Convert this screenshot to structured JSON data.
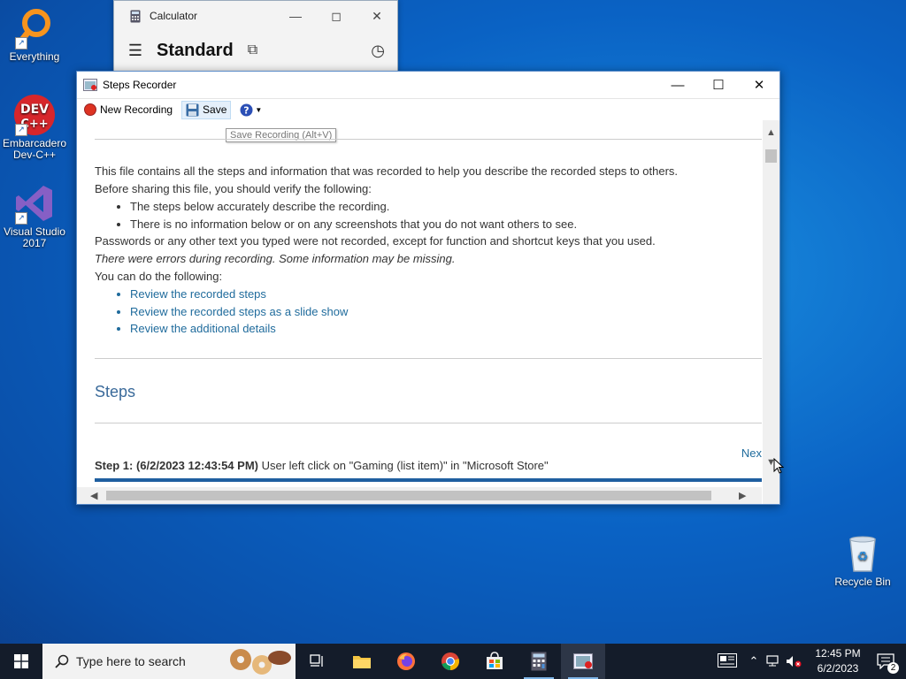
{
  "desktop": {
    "icons": [
      {
        "label": "Everything"
      },
      {
        "label": "Embarcadero Dev-C++"
      },
      {
        "label": "Visual Studio 2017"
      },
      {
        "label": "Recycle Bin"
      }
    ]
  },
  "calculator": {
    "title": "Calculator",
    "mode": "Standard"
  },
  "steps_recorder": {
    "title": "Steps Recorder",
    "toolbar": {
      "new_recording": "New Recording",
      "save": "Save",
      "save_tooltip": "Save Recording (Alt+V)"
    },
    "intro": "This file contains all the steps and information that was recorded to help you describe the recorded steps to others.",
    "verify_heading": "Before sharing this file, you should verify the following:",
    "verify_items": [
      "The steps below accurately describe the recording.",
      "There is no information below or on any screenshots that you do not want others to see."
    ],
    "passwords_note": "Passwords or any other text you typed were not recorded, except for function and shortcut keys that you used.",
    "errors_note": "There were errors during recording. Some information may be missing.",
    "you_can": "You can do the following:",
    "links": [
      "Review the recorded steps",
      "Review the recorded steps as a slide show",
      "Review the additional details"
    ],
    "steps_heading": "Steps",
    "next_link": "Nex",
    "step1": {
      "label": "Step 1: (6/2/2023 12:43:54 PM)",
      "text": " User left click on \"Gaming (list item)\" in \"Microsoft Store\""
    }
  },
  "taskbar": {
    "search_placeholder": "Type here to search",
    "clock": {
      "time": "12:45 PM",
      "date": "6/2/2023"
    },
    "notifications_count": "2"
  }
}
